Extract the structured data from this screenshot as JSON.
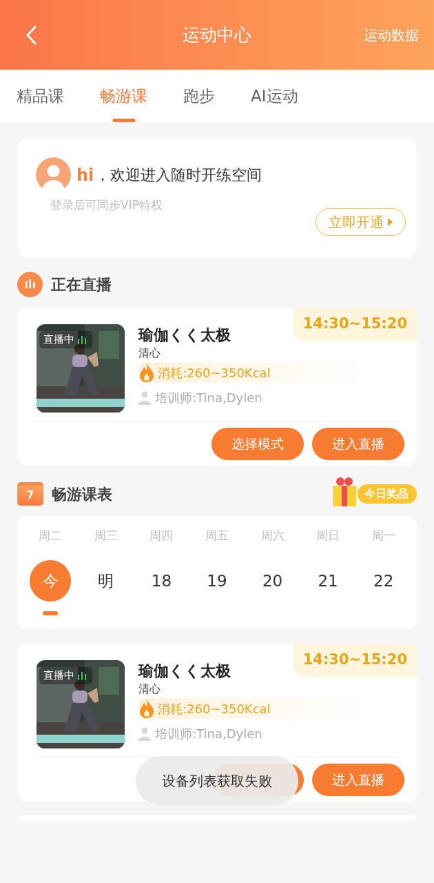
{
  "header": {
    "title": "运动中心",
    "action": "运动数据"
  },
  "tabs": [
    {
      "label": "精品课",
      "selected": false
    },
    {
      "label": "畅游课",
      "selected": true
    },
    {
      "label": "跑步",
      "selected": false
    },
    {
      "label": "AI运动",
      "selected": false
    }
  ],
  "welcome": {
    "greeting": "hi",
    "message": "，欢迎进入随时开练空间",
    "note": "登录后可同步VIP特权",
    "button": "立即开通"
  },
  "live_section": {
    "title": "正在直播",
    "courses": [
      {
        "time": "14:30~15:20",
        "live_badge": "直播中",
        "title": "瑜伽くく太极",
        "subtitle": "清心",
        "calories": "消耗:260~350Kcal",
        "trainer": "培训师:Tina,Dylen",
        "buttons": [
          {
            "kind": "text",
            "label": "选择模式"
          },
          {
            "kind": "text",
            "label": "进入直播"
          }
        ]
      }
    ]
  },
  "schedule": {
    "title": "畅游课表",
    "calendar_number": "7",
    "reward": "今日奖品",
    "days": [
      {
        "weekday": "周二",
        "date": "今",
        "selected": true
      },
      {
        "weekday": "周三",
        "date": "明",
        "selected": false
      },
      {
        "weekday": "周四",
        "date": "18",
        "selected": false
      },
      {
        "weekday": "周五",
        "date": "19",
        "selected": false
      },
      {
        "weekday": "周六",
        "date": "20",
        "selected": false
      },
      {
        "weekday": "周日",
        "date": "21",
        "selected": false
      },
      {
        "weekday": "周一",
        "date": "22",
        "selected": false
      }
    ],
    "courses": [
      {
        "time": "14:30~15:20",
        "live_badge": "直播中",
        "title": "瑜伽くく太极",
        "subtitle": "清心",
        "calories": "消耗:260~350Kcal",
        "trainer": "培训师:Tina,Dylen",
        "buttons": [
          {
            "kind": "blank"
          },
          {
            "kind": "text",
            "label": "进入直播"
          }
        ]
      }
    ]
  },
  "toast": "设备列表获取失败"
}
